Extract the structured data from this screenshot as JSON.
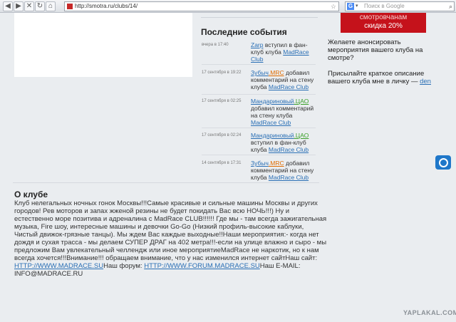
{
  "browser": {
    "url": "http://smotra.ru/clubs/14/",
    "search_placeholder": "Поиск в Google",
    "search_engine": "G"
  },
  "events": {
    "title": "Последние события",
    "items": [
      {
        "date": "вчера в 17:40",
        "user": "Zarp",
        "user_suffix": "",
        "action": "вступил в фан-клуб клуба",
        "club": "MadRace Club"
      },
      {
        "date": "17 сентября в 19:22",
        "user": "Зубыч",
        "user_suffix": ".MRC",
        "action": "добавил комментарий на стену клуба",
        "club": "MadRace Club"
      },
      {
        "date": "17 сентября в 02:25",
        "user": "Мандариновый",
        "user_suffix": ".ЦАО",
        "action": "добавил комментарий на стену клуба",
        "club": "MadRace Club"
      },
      {
        "date": "17 сентября в 02:24",
        "user": "Мандариновый",
        "user_suffix": ".ЦАО",
        "action": "вступил в фан-клуб клуба",
        "club": "MadRace Club"
      },
      {
        "date": "14 сентября в 17:31",
        "user": "Зубыч",
        "user_suffix": ".MRC",
        "action": "добавил комментарий на стену клуба",
        "club": "MadRace Club"
      }
    ]
  },
  "promo": {
    "line1": "смотровчанам",
    "line2": "скидка 20%"
  },
  "sidebar": {
    "announce": "Желаете анонсировать мероприятия вашего клуба на смотре?",
    "send_prefix": "Присылайте краткое описание вашего клуба мне в личку — ",
    "send_link": "den"
  },
  "about": {
    "title": "О клубе",
    "text": "Клуб нелегальных ночных гонок Москвы!!!Самые красивые и сильные машины Москвы и других городов! Рев моторов и запах жженой резины не будет покидать Вас всю НОЧЬ!!!) Ну и естественно море позитива и адреналина с MadRace CLUB!!!!!! Где мы - там всегда зажигательная музыка, Fire шоу, интересные машины и девочки Go-Go (Низкий профиль-высокие каблуки, Чистый движок-грязные танцы). Мы ждем Вас каждые выходные!!Наши мероприятия:- когда нет дождя и сухая трасса - мы делаем СУПЕР ДРАГ на 402 метра!!!-если на улице влажно и сыро - мы предложим Вам увлекательный челлендж или иное мероприятиеMadRace не наркотик, но к нам всегда хочется!!!Внимание!!! обращаем внимание, что у нас изменился интернет сайтНаш сайт: ",
    "site": "HTTP://WWW.MADRACE.SU",
    "forum_prefix": "Наш форум: ",
    "forum": "HTTP://WWW.FORUM.MADRACE.SU",
    "email_text": "Наш E-MAIL: INFO@MADRACE.RU"
  },
  "watermark": "YAPLAKAL.COM",
  "colors": {
    "promo_bg": "#c5121b",
    "link": "#2a6fb5",
    "mrc": "#e06c00",
    "cao": "#3aa02a"
  }
}
